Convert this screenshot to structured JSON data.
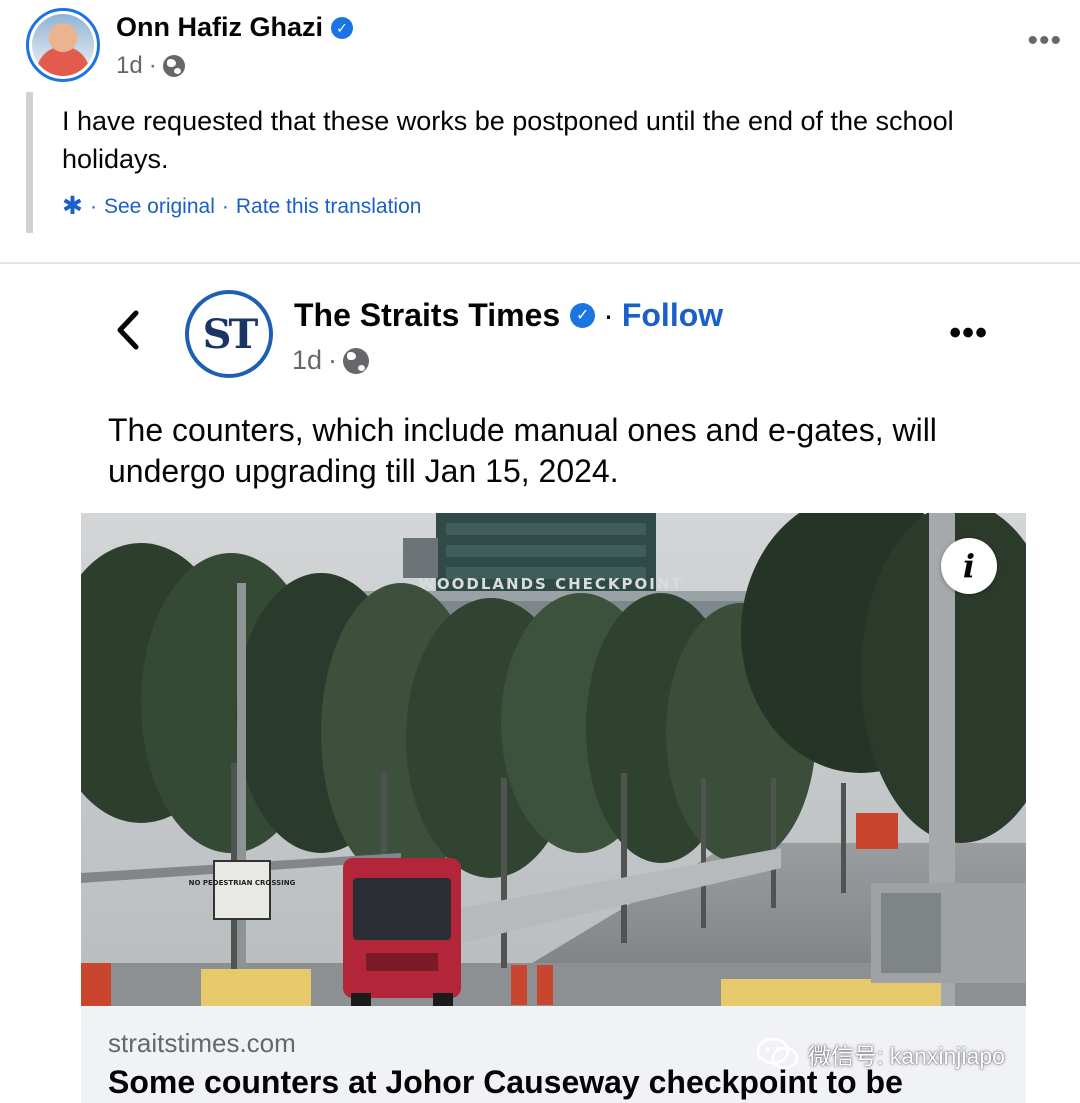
{
  "post": {
    "author": "Onn Hafiz Ghazi",
    "time": "1d",
    "meta_sep": "·",
    "more": "•••",
    "text": "I have requested that these works be postponed until the end of the school holidays.",
    "translation": {
      "sep1": "·",
      "see_original": "See original",
      "sep2": "·",
      "rate": "Rate this translation"
    }
  },
  "shared": {
    "page_logo": "ST",
    "page_name": "The Straits Times",
    "follow_sep": "·",
    "follow": "Follow",
    "time": "1d",
    "meta_sep": "·",
    "more": "•••",
    "text": "The counters, which include manual ones and e-gates, will undergo upgrading till Jan 15, 2024.",
    "photo": {
      "building_sign": "WOODLANDS CHECKPOINT",
      "road_sign": "NO PEDESTRIAN CROSSING",
      "info": "i"
    },
    "link": {
      "domain": "straitstimes.com",
      "title": "Some counters at Johor Causeway checkpoint to be"
    }
  },
  "watermark": {
    "text": "微信号: kanxinjiapo"
  },
  "colors": {
    "accent": "#1b74e4",
    "link": "#1b5fc9",
    "muted": "#65676b",
    "card_bg": "#f0f2f5",
    "bus": "#b3263a"
  }
}
